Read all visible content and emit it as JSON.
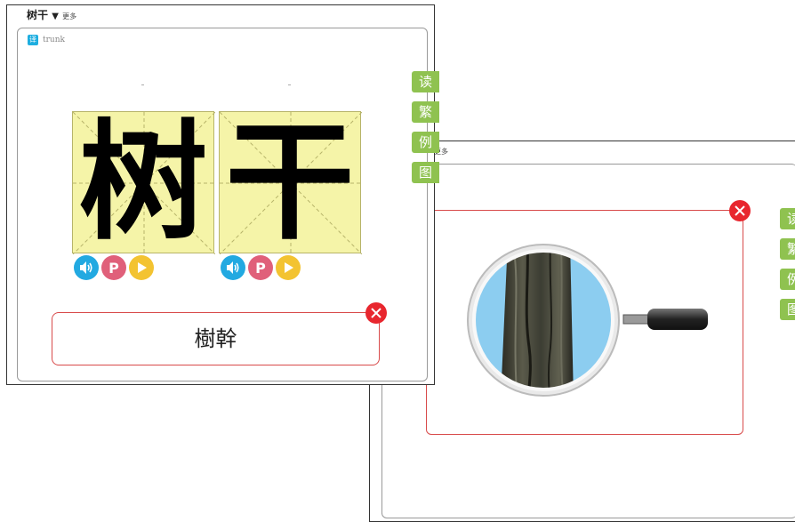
{
  "window_back": {
    "more_label": "更多",
    "side_buttons": [
      "读",
      "繁",
      "例",
      "图"
    ]
  },
  "window_front": {
    "title": "树干",
    "caret": "▼",
    "more_label": "更多",
    "tag_icon": "译",
    "tag_text": "trunk",
    "side_buttons": [
      "读",
      "繁",
      "例",
      "图"
    ],
    "characters": [
      "树",
      "干"
    ],
    "traditional": "樹幹",
    "controls": {
      "p_label": "P"
    },
    "icons": {
      "sound": "speaker-icon",
      "play": "play-icon",
      "close": "close-icon"
    }
  },
  "colors": {
    "accent_green": "#8fc250",
    "cell_yellow": "#f5f4a8",
    "close_red": "#e8262e",
    "sound_blue": "#22a9e1",
    "p_pink": "#e0607a",
    "play_yellow": "#f3c331",
    "sky_blue": "#8ccdf0"
  }
}
